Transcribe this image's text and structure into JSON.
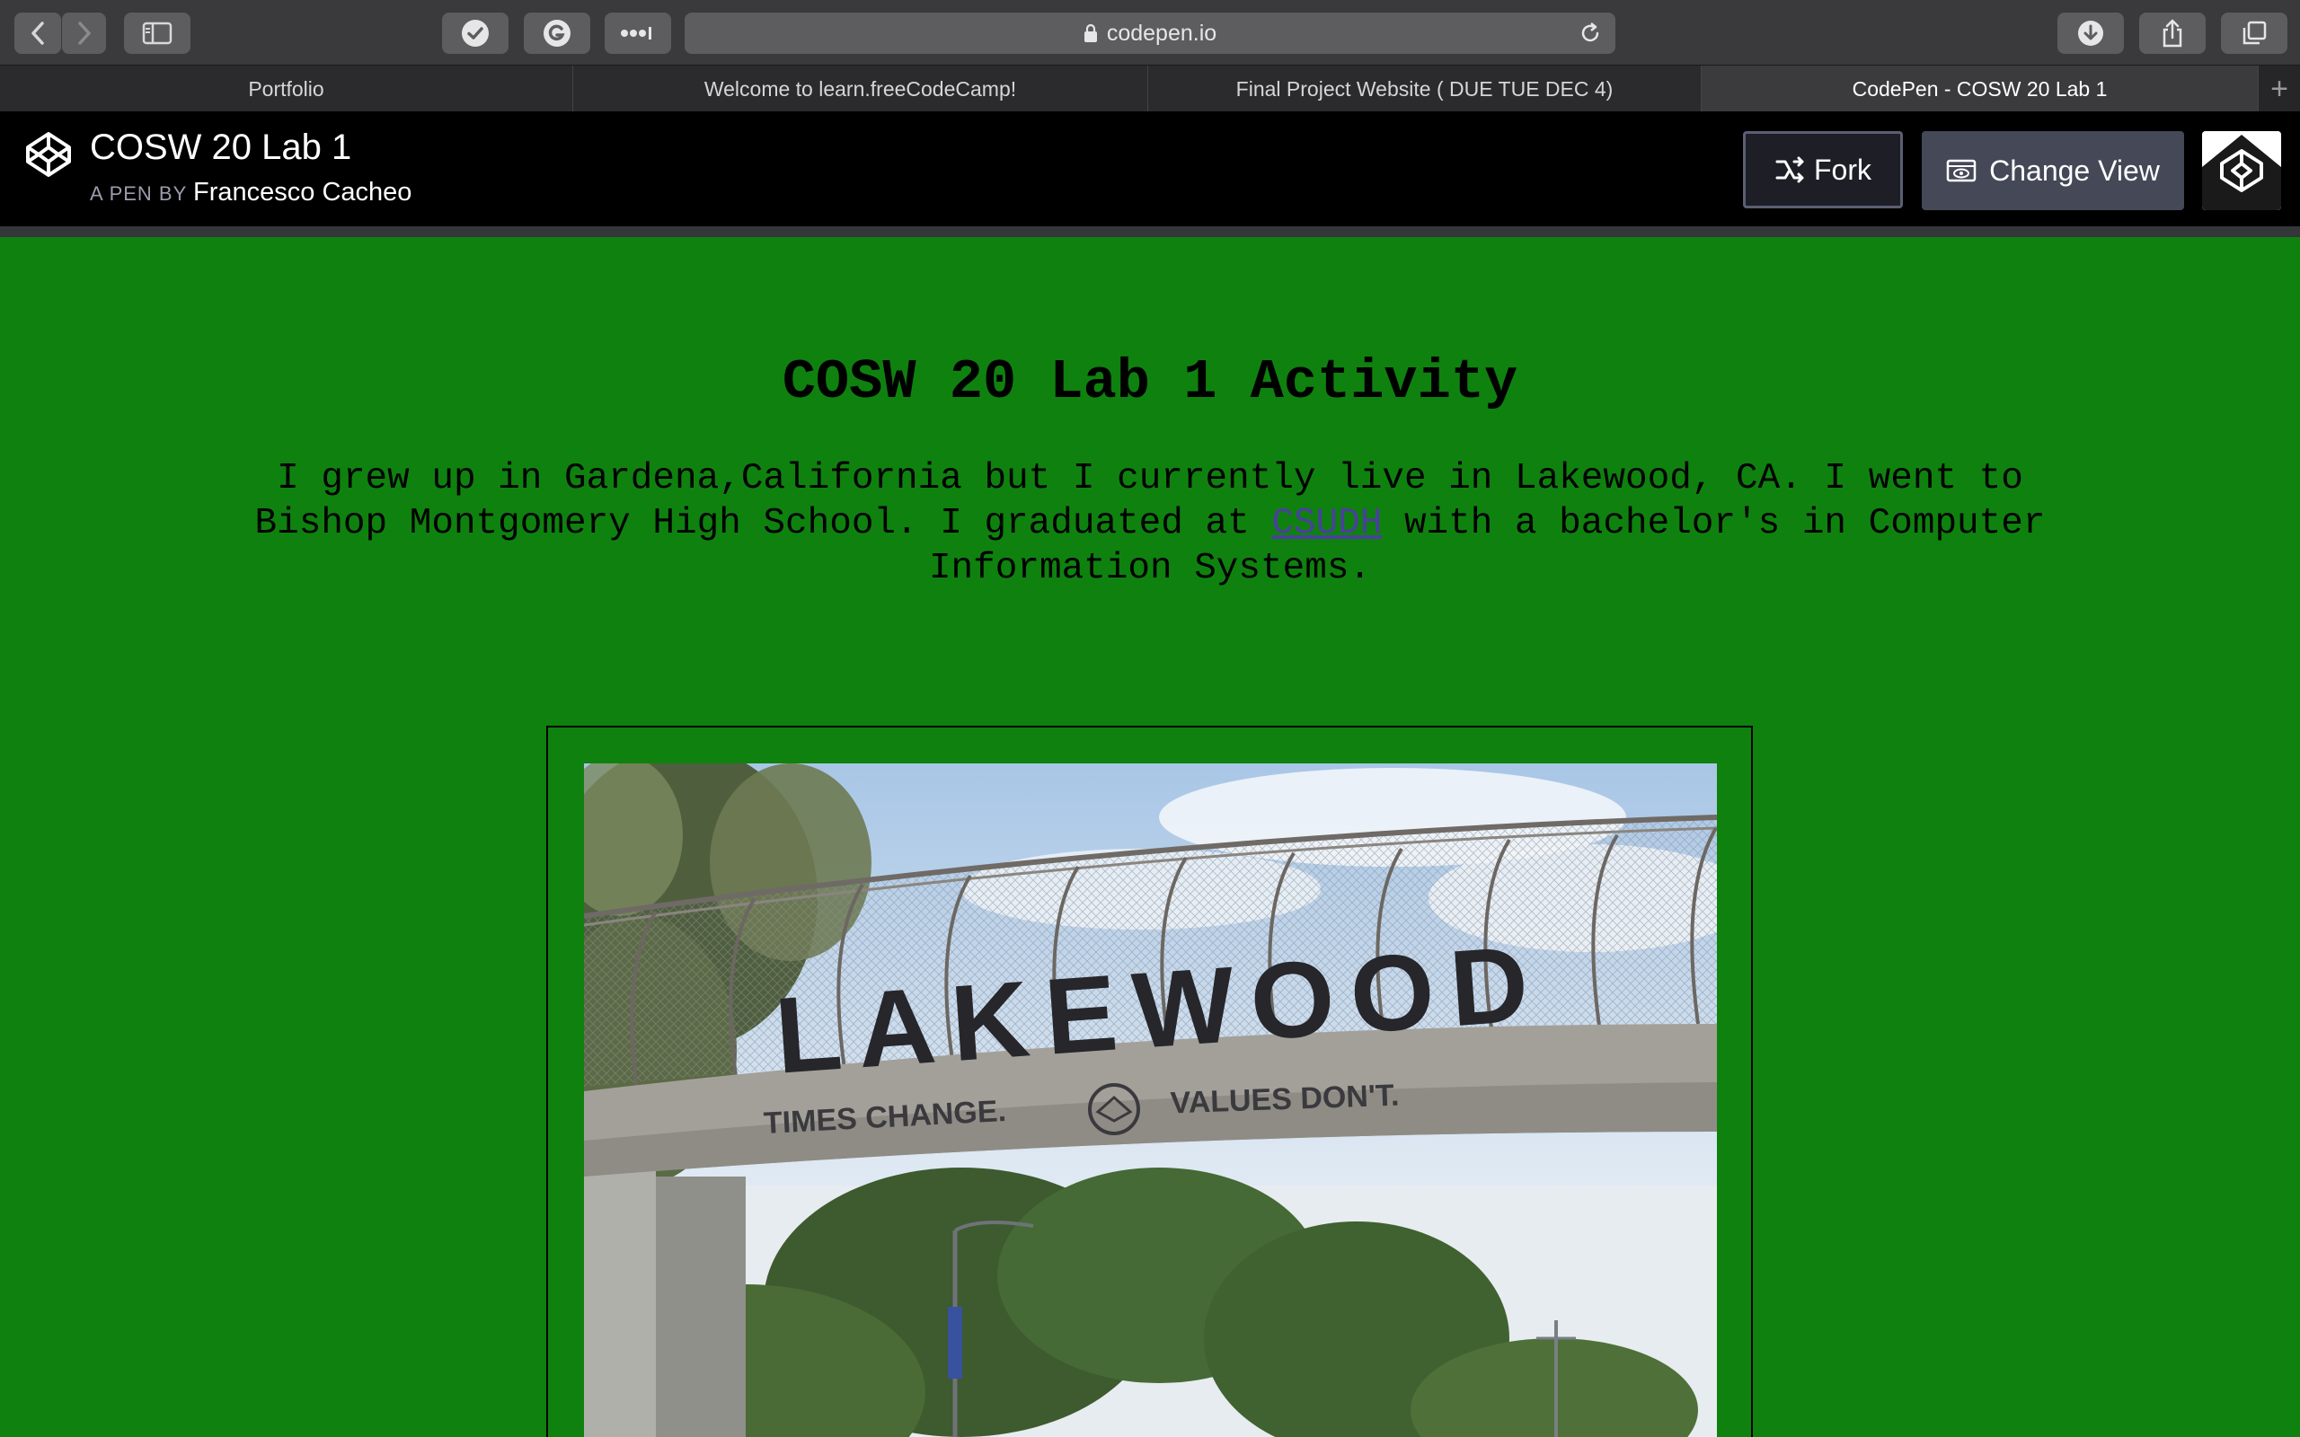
{
  "browser": {
    "url": "codepen.io",
    "tabs": [
      {
        "label": "Portfolio",
        "active": false
      },
      {
        "label": "Welcome to learn.freeCodeCamp!",
        "active": false
      },
      {
        "label": "Final Project Website ( DUE TUE DEC 4)",
        "active": false
      },
      {
        "label": "CodePen - COSW 20 Lab 1",
        "active": true
      }
    ],
    "new_tab_symbol": "+"
  },
  "codepen": {
    "pen_title": "COSW 20 Lab 1",
    "byline_prefix": "A PEN BY",
    "author": "Francesco Cacheo",
    "fork_label": "Fork",
    "change_view_label": "Change View"
  },
  "page": {
    "heading": "COSW 20 Lab 1 Activity",
    "intro_before_link": "I grew up in Gardena,California but I currently live in Lakewood, CA. I went to Bishop Montgomery High School. I graduated at ",
    "intro_link": "CSUDH",
    "intro_after_link": " with a bachelor's in Computer Information Systems.",
    "photo": {
      "sign_text": "LAKEWOOD",
      "motto_left": "TIMES CHANGE.",
      "motto_right": "VALUES DON'T."
    }
  },
  "colors": {
    "page_background": "#0f810f",
    "link": "#4b3f9e",
    "header_background": "#000000"
  }
}
